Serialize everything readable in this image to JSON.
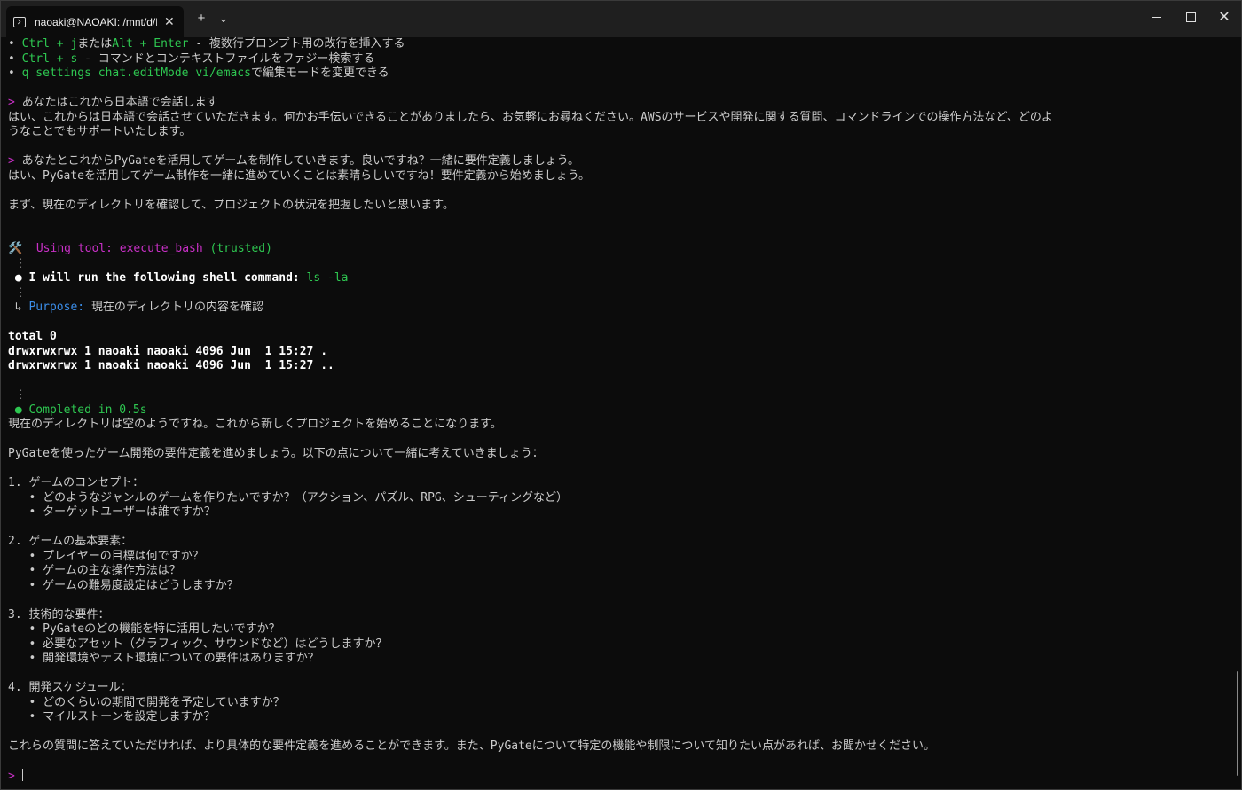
{
  "tab": {
    "title": "naoaki@NAOAKI: /mnt/d/ROC"
  },
  "titlebar_buttons": {
    "new_tab": "+",
    "dropdown": "⌄",
    "close_tab": "✕"
  },
  "terminal": {
    "lines": [
      [
        {
          "t": "• ",
          "c": ""
        },
        {
          "t": "Ctrl + j",
          "c": "g"
        },
        {
          "t": "または",
          "c": ""
        },
        {
          "t": "Alt + Enter",
          "c": "g"
        },
        {
          "t": " - 複数行プロンプト用の改行を挿入する",
          "c": ""
        }
      ],
      [
        {
          "t": "• ",
          "c": ""
        },
        {
          "t": "Ctrl + s",
          "c": "g"
        },
        {
          "t": " - コマンドとコンテキストファイルをファジー検索する",
          "c": ""
        }
      ],
      [
        {
          "t": "• ",
          "c": ""
        },
        {
          "t": "q settings chat.editMode vi/emacs",
          "c": "g"
        },
        {
          "t": "で編集モードを変更できる",
          "c": ""
        }
      ],
      [],
      [
        {
          "t": "> ",
          "c": "m"
        },
        {
          "t": "あなたはこれから日本語で会話します",
          "c": ""
        }
      ],
      [
        {
          "t": "はい、これからは日本語で会話させていただきます。何かお手伝いできることがありましたら、お気軽にお尋ねください。AWSのサービスや開発に関する質問、コマンドラインでの操作方法など、どのよ",
          "c": ""
        }
      ],
      [
        {
          "t": "うなことでもサポートいたします。",
          "c": ""
        }
      ],
      [],
      [
        {
          "t": "> ",
          "c": "m"
        },
        {
          "t": "あなたとこれからPyGateを活用してゲームを制作していきます。良いですね？一緒に要件定義しましょう。",
          "c": ""
        }
      ],
      [
        {
          "t": "はい、PyGateを活用してゲーム制作を一緒に進めていくことは素晴らしいですね！要件定義から始めましょう。",
          "c": ""
        }
      ],
      [],
      [
        {
          "t": "まず、現在のディレクトリを確認して、プロジェクトの状況を把握したいと思います。",
          "c": ""
        }
      ],
      [],
      [],
      [
        {
          "t": "🛠️  ",
          "c": ""
        },
        {
          "t": "Using tool: execute_bash",
          "c": "m"
        },
        {
          "t": " (trusted)",
          "c": "g"
        }
      ],
      [
        {
          "t": " ⋮",
          "c": "dim"
        }
      ],
      [
        {
          "t": " ● I will run the following shell command: ",
          "c": "wb"
        },
        {
          "t": "ls -la",
          "c": "g"
        }
      ],
      [
        {
          "t": " ⋮",
          "c": "dim"
        }
      ],
      [
        {
          "t": " ↳ ",
          "c": ""
        },
        {
          "t": "Purpose:",
          "c": "b"
        },
        {
          "t": " 現在のディレクトリの内容を確認",
          "c": ""
        }
      ],
      [],
      [
        {
          "t": "total 0",
          "c": "wb"
        }
      ],
      [
        {
          "t": "drwxrwxrwx 1 naoaki naoaki 4096 Jun  1 15:27 .",
          "c": "wb"
        }
      ],
      [
        {
          "t": "drwxrwxrwx 1 naoaki naoaki 4096 Jun  1 15:27 ..",
          "c": "wb"
        }
      ],
      [],
      [
        {
          "t": " ⋮",
          "c": "dim"
        }
      ],
      [
        {
          "t": " ● Completed in 0.5s",
          "c": "g"
        }
      ],
      [
        {
          "t": "現在のディレクトリは空のようですね。これから新しくプロジェクトを始めることになります。",
          "c": ""
        }
      ],
      [],
      [
        {
          "t": "PyGateを使ったゲーム開発の要件定義を進めましょう。以下の点について一緒に考えていきましょう：",
          "c": ""
        }
      ],
      [],
      [
        {
          "t": "1. ゲームのコンセプト：",
          "c": ""
        }
      ],
      [
        {
          "t": "   • どのようなジャンルのゲームを作りたいですか？（アクション、パズル、RPG、シューティングなど）",
          "c": ""
        }
      ],
      [
        {
          "t": "   • ターゲットユーザーは誰ですか？",
          "c": ""
        }
      ],
      [],
      [
        {
          "t": "2. ゲームの基本要素：",
          "c": ""
        }
      ],
      [
        {
          "t": "   • プレイヤーの目標は何ですか？",
          "c": ""
        }
      ],
      [
        {
          "t": "   • ゲームの主な操作方法は？",
          "c": ""
        }
      ],
      [
        {
          "t": "   • ゲームの難易度設定はどうしますか？",
          "c": ""
        }
      ],
      [],
      [
        {
          "t": "3. 技術的な要件：",
          "c": ""
        }
      ],
      [
        {
          "t": "   • PyGateのどの機能を特に活用したいですか？",
          "c": ""
        }
      ],
      [
        {
          "t": "   • 必要なアセット（グラフィック、サウンドなど）はどうしますか？",
          "c": ""
        }
      ],
      [
        {
          "t": "   • 開発環境やテスト環境についての要件はありますか？",
          "c": ""
        }
      ],
      [],
      [
        {
          "t": "4. 開発スケジュール：",
          "c": ""
        }
      ],
      [
        {
          "t": "   • どのくらいの期間で開発を予定していますか？",
          "c": ""
        }
      ],
      [
        {
          "t": "   • マイルストーンを設定しますか？",
          "c": ""
        }
      ],
      [],
      [
        {
          "t": "これらの質問に答えていただければ、より具体的な要件定義を進めることができます。また、PyGateについて特定の機能や制限について知りたい点があれば、お聞かせください。",
          "c": ""
        }
      ],
      []
    ],
    "prompt": "> ",
    "input_value": ""
  }
}
